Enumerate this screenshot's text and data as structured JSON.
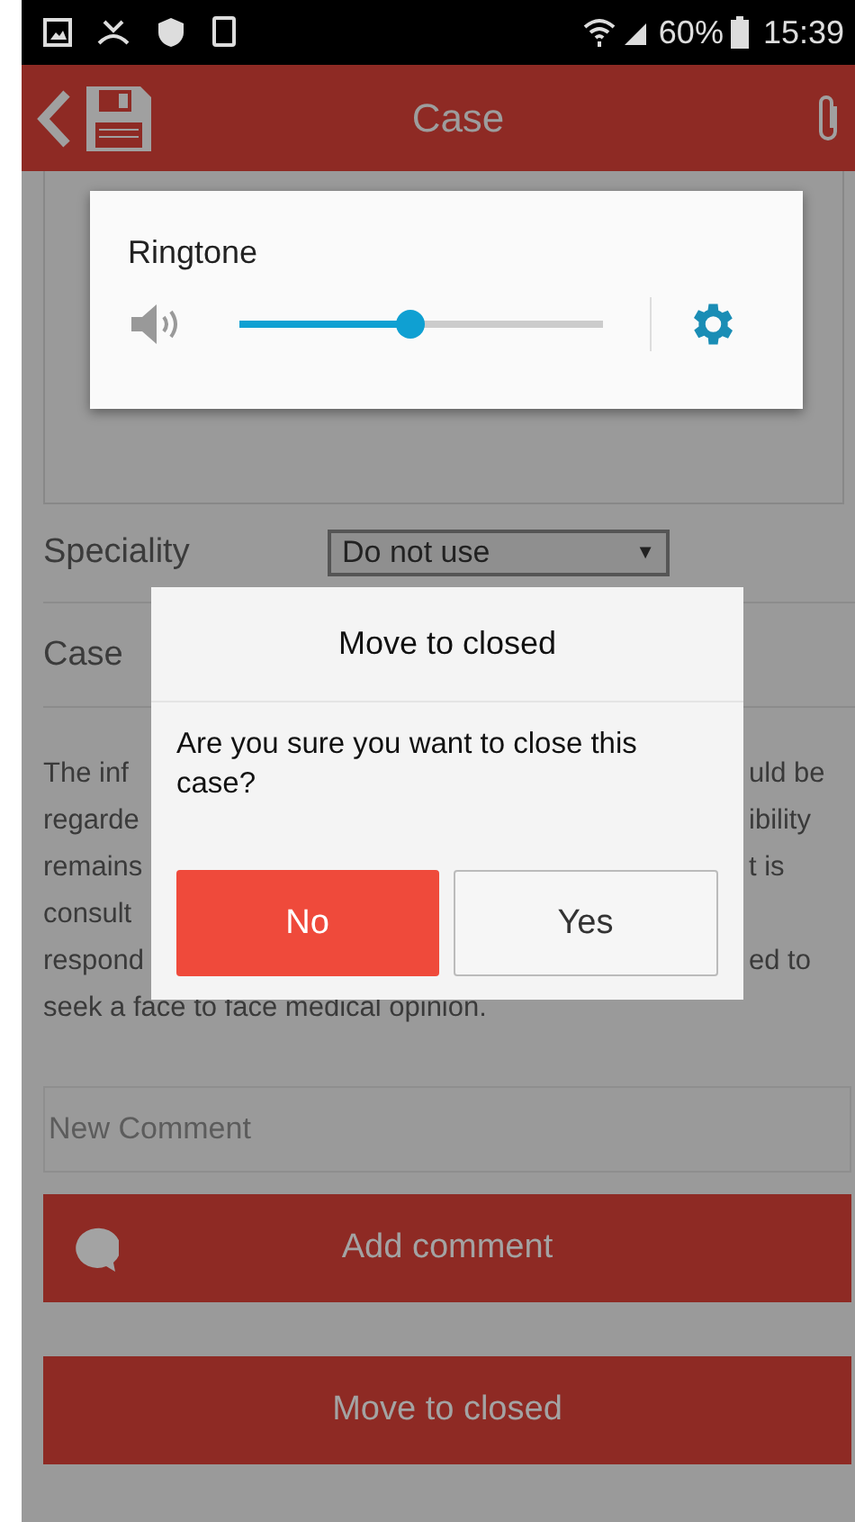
{
  "status_bar": {
    "battery": "60%",
    "time": "15:39"
  },
  "toolbar": {
    "title": "Case"
  },
  "volume_popup": {
    "label": "Ringtone",
    "level": 0.47
  },
  "form": {
    "fields": [
      {
        "label": "Speciality",
        "kind": "select",
        "value": "Do not use",
        "arrow": "▼"
      },
      {
        "label": "Case",
        "kind": "text"
      }
    ]
  },
  "disclaimer": [
    {
      "left": "The inf",
      "right": "uld be"
    },
    {
      "left": "regarde",
      "right": "ibility"
    },
    {
      "left": "remains",
      "right": "t is"
    },
    {
      "left": "consult"
    },
    {
      "left": "respond",
      "right": "ed to"
    },
    {
      "left": "seek a face to face medical opinion."
    }
  ],
  "comment": {
    "placeholder": "New Comment"
  },
  "buttons": [
    {
      "label": "Add comment",
      "kind": "comment"
    },
    {
      "label": "Move to closed",
      "kind": "plain"
    }
  ],
  "dialog": {
    "title": "Move to closed",
    "message": "Are you sure you want to close this case?",
    "actions": [
      {
        "label": "No",
        "primary": true
      },
      {
        "label": "Yes",
        "primary": false
      }
    ]
  }
}
